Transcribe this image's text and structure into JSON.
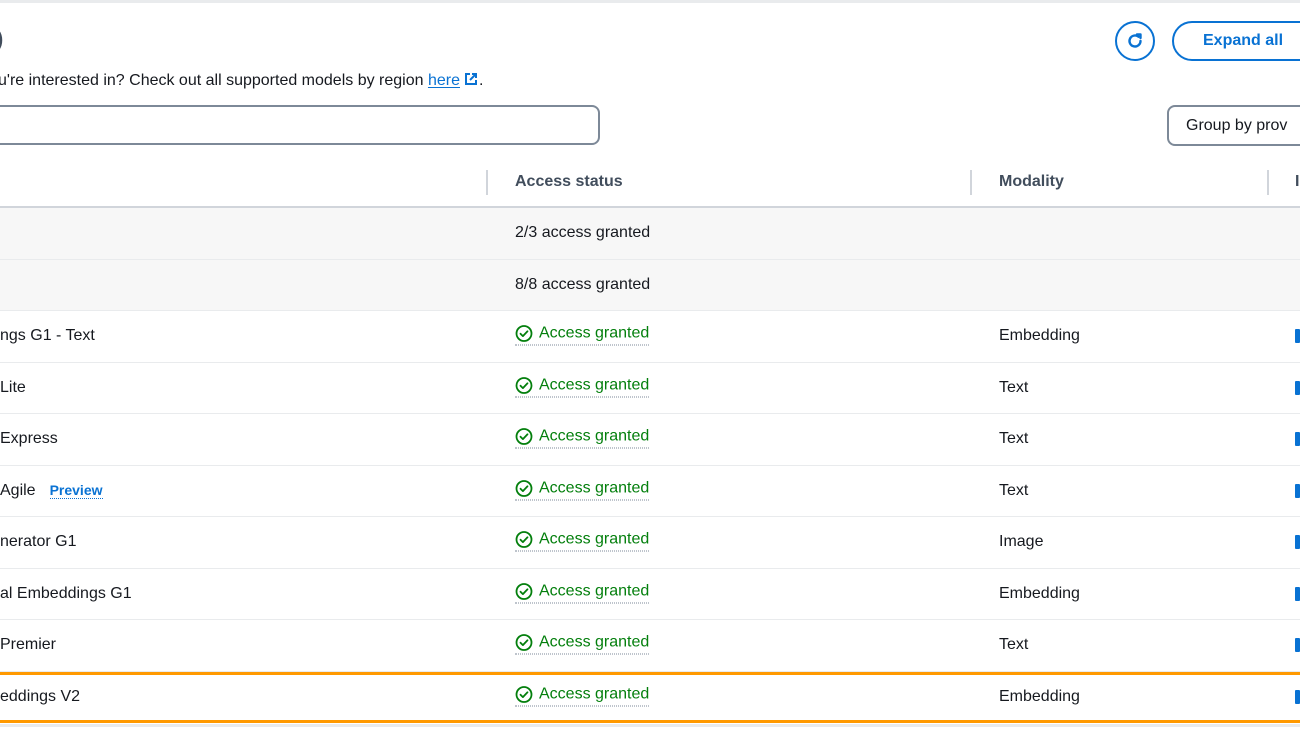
{
  "header": {
    "title_fragment": ")",
    "description_prefix": "u're interested in? Check out all supported models by region ",
    "description_link": "here",
    "description_suffix": ".",
    "search_placeholder": "",
    "refresh_label": "Refresh",
    "expand_all_label": "Expand all",
    "group_by_label": "Group by prov"
  },
  "table": {
    "columns": [
      {
        "label": ""
      },
      {
        "label": "Access status"
      },
      {
        "label": "Modality"
      },
      {
        "label": "I"
      }
    ],
    "group_rows": [
      {
        "name": "",
        "access": "2/3 access granted"
      },
      {
        "name": "",
        "access": "8/8 access granted"
      }
    ],
    "rows": [
      {
        "name": "ngs G1 - Text",
        "access": "Access granted",
        "modality": "Embedding",
        "badge": ""
      },
      {
        "name": " Lite",
        "access": "Access granted",
        "modality": "Text",
        "badge": ""
      },
      {
        "name": " Express",
        "access": "Access granted",
        "modality": "Text",
        "badge": ""
      },
      {
        "name": " Agile",
        "access": "Access granted",
        "modality": "Text",
        "badge": "Preview"
      },
      {
        "name": "nerator G1",
        "access": "Access granted",
        "modality": "Image",
        "badge": ""
      },
      {
        "name": "al Embeddings G1",
        "access": "Access granted",
        "modality": "Embedding",
        "badge": ""
      },
      {
        "name": " Premier",
        "access": "Access granted",
        "modality": "Text",
        "badge": ""
      },
      {
        "name": "eddings V2",
        "access": "Access granted",
        "modality": "Embedding",
        "badge": "",
        "selected": true
      }
    ]
  },
  "colors": {
    "accent": "#0972d3",
    "success": "#037f0c",
    "selection": "#ff9900",
    "heading": "#414d5c"
  }
}
